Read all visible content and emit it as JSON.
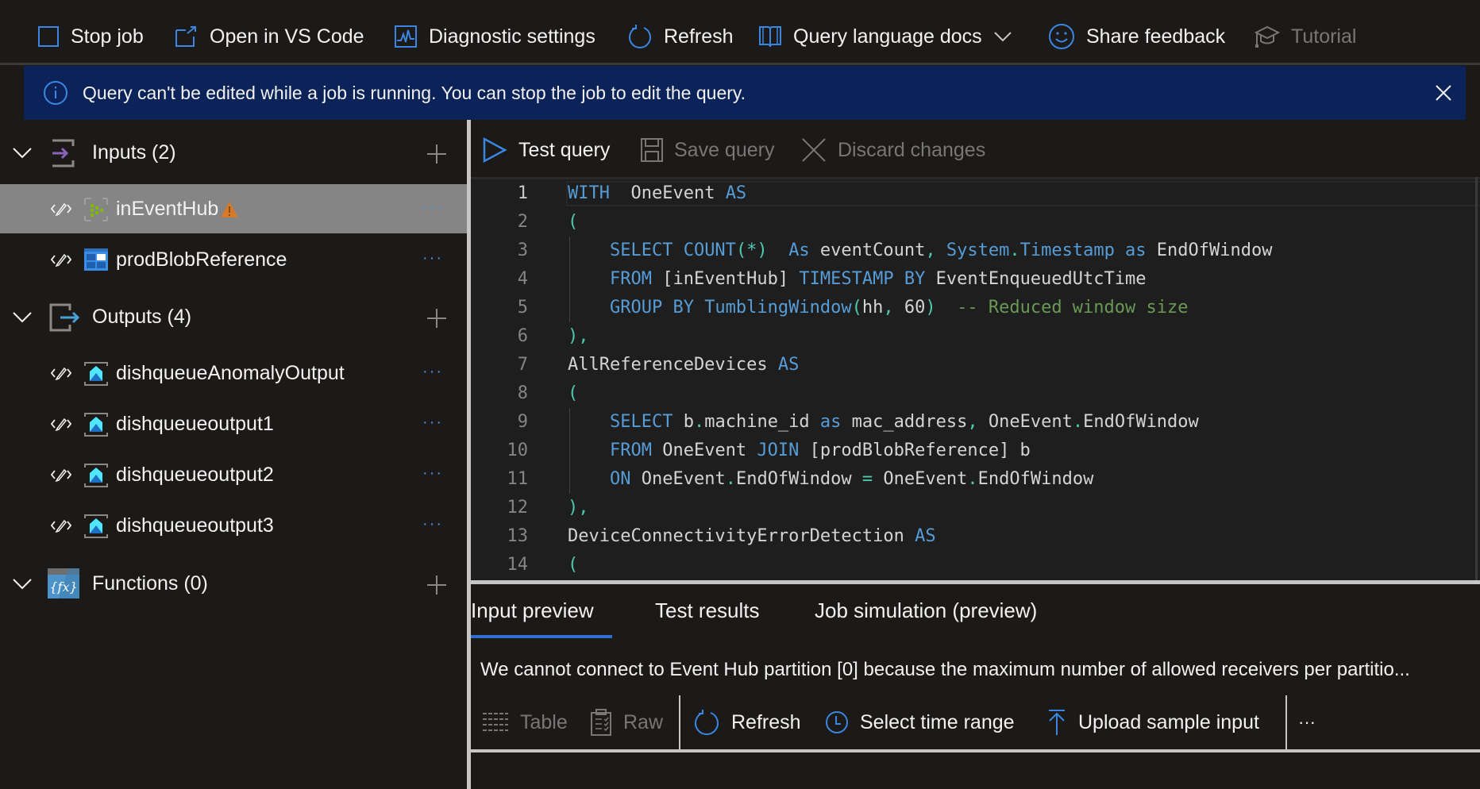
{
  "toolbar": {
    "stop_job": "Stop job",
    "open_vscode": "Open in VS Code",
    "diagnostic_settings": "Diagnostic settings",
    "refresh": "Refresh",
    "query_docs": "Query language docs",
    "share_feedback": "Share feedback",
    "tutorial": "Tutorial"
  },
  "banner": {
    "icon": "info-icon",
    "text": "Query can't be edited while a job is running. You can stop the job to edit the query."
  },
  "tree": {
    "inputs": {
      "label": "Inputs (2)",
      "items": [
        {
          "name": "inEventHub",
          "icon": "event-hub-icon",
          "warning": true,
          "selected": true
        },
        {
          "name": "prodBlobReference",
          "icon": "blob-storage-icon",
          "warning": false,
          "selected": false
        }
      ]
    },
    "outputs": {
      "label": "Outputs (4)",
      "items": [
        {
          "name": "dishqueueAnomalyOutput",
          "icon": "queue-icon"
        },
        {
          "name": "dishqueueoutput1",
          "icon": "queue-icon"
        },
        {
          "name": "dishqueueoutput2",
          "icon": "queue-icon"
        },
        {
          "name": "dishqueueoutput3",
          "icon": "queue-icon"
        }
      ]
    },
    "functions": {
      "label": "Functions (0)"
    },
    "more_label": "···"
  },
  "query_toolbar": {
    "test_query": "Test query",
    "save_query": "Save query",
    "discard_changes": "Discard changes"
  },
  "editor": {
    "active_line": 1,
    "lines": [
      {
        "n": "1",
        "tokens": [
          [
            "kw",
            "WITH"
          ],
          [
            "",
            "  OneEvent "
          ],
          [
            "kw",
            "AS"
          ]
        ]
      },
      {
        "n": "2",
        "tokens": [
          [
            "punc",
            "("
          ]
        ]
      },
      {
        "n": "3",
        "tokens": [
          [
            "",
            "    "
          ],
          [
            "kw",
            "SELECT COUNT"
          ],
          [
            "punc",
            "(*)"
          ],
          [
            "",
            "  "
          ],
          [
            "kw",
            "As"
          ],
          [
            "",
            " eventCount"
          ],
          [
            "punc",
            ","
          ],
          [
            "",
            ""
          ],
          [
            "kw",
            " System"
          ],
          [
            "punc",
            "."
          ],
          [
            "kw",
            "Timestamp as"
          ],
          [
            "",
            " EndOfWindow"
          ]
        ]
      },
      {
        "n": "4",
        "tokens": [
          [
            "",
            "    "
          ],
          [
            "kw",
            "FROM"
          ],
          [
            "",
            " [inEventHub] "
          ],
          [
            "kw",
            "TIMESTAMP BY"
          ],
          [
            "",
            " EventEnqueuedUtcTime"
          ]
        ]
      },
      {
        "n": "5",
        "tokens": [
          [
            "",
            "    "
          ],
          [
            "kw",
            "GROUP BY TumblingWindow"
          ],
          [
            "punc",
            "("
          ],
          [
            "",
            "hh"
          ],
          [
            "punc",
            ","
          ],
          [
            "",
            " 60"
          ],
          [
            "punc",
            ")"
          ],
          [
            "cm",
            "  -- Reduced window size"
          ]
        ]
      },
      {
        "n": "6",
        "tokens": [
          [
            "punc",
            "),"
          ]
        ]
      },
      {
        "n": "7",
        "tokens": [
          [
            "",
            "AllReferenceDevices "
          ],
          [
            "kw",
            "AS"
          ]
        ]
      },
      {
        "n": "8",
        "tokens": [
          [
            "punc",
            "("
          ]
        ]
      },
      {
        "n": "9",
        "tokens": [
          [
            "",
            "    "
          ],
          [
            "kw",
            "SELECT"
          ],
          [
            "",
            " b"
          ],
          [
            "punc",
            "."
          ],
          [
            "",
            "machine_id "
          ],
          [
            "kw",
            "as"
          ],
          [
            "",
            " mac_address"
          ],
          [
            "punc",
            ","
          ],
          [
            "",
            " OneEvent"
          ],
          [
            "punc",
            "."
          ],
          [
            "",
            "EndOfWindow"
          ]
        ]
      },
      {
        "n": "10",
        "tokens": [
          [
            "",
            "    "
          ],
          [
            "kw",
            "FROM"
          ],
          [
            "",
            " OneEvent "
          ],
          [
            "kw",
            "JOIN"
          ],
          [
            "",
            " [prodBlobReference] b"
          ]
        ]
      },
      {
        "n": "11",
        "tokens": [
          [
            "",
            "    "
          ],
          [
            "kw",
            "ON"
          ],
          [
            "",
            " OneEvent"
          ],
          [
            "punc",
            "."
          ],
          [
            "",
            "EndOfWindow "
          ],
          [
            "punc",
            "="
          ],
          [
            "",
            " OneEvent"
          ],
          [
            "punc",
            "."
          ],
          [
            "",
            "EndOfWindow"
          ]
        ]
      },
      {
        "n": "12",
        "tokens": [
          [
            "punc",
            "),"
          ]
        ]
      },
      {
        "n": "13",
        "tokens": [
          [
            "",
            "DeviceConnectivityErrorDetection "
          ],
          [
            "kw",
            "AS"
          ]
        ]
      },
      {
        "n": "14",
        "tokens": [
          [
            "punc",
            "("
          ]
        ]
      }
    ]
  },
  "bottom": {
    "tabs": [
      {
        "label": "Input preview",
        "active": true
      },
      {
        "label": "Test results",
        "active": false
      },
      {
        "label": "Job simulation (preview)",
        "active": false
      }
    ],
    "message": "We cannot connect to Event Hub partition [0] because the maximum number of allowed receivers per partitio...",
    "toolbar": {
      "table": "Table",
      "raw": "Raw",
      "refresh": "Refresh",
      "select_time_range": "Select time range",
      "upload_sample_input": "Upload sample input",
      "more": "···"
    }
  },
  "colors": {
    "accent": "#2f6fd0",
    "banner_bg": "#0b2359",
    "selected_row": "#858585",
    "warning": "#d47a2a",
    "keyword": "#569cd6",
    "punctuation": "#4ec9b0",
    "comment": "#6a9955"
  }
}
